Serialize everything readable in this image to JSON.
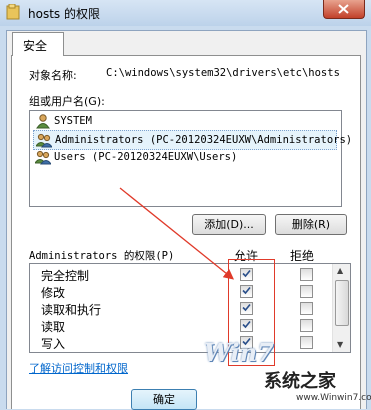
{
  "window": {
    "title": "hosts 的权限",
    "accent": "#c9dbee",
    "icons": {
      "folder": "folder-icon",
      "close": "close-icon"
    }
  },
  "tab": {
    "label": "安全"
  },
  "object": {
    "label": "对象名称:",
    "value": "C:\\windows\\system32\\drivers\\etc\\hosts"
  },
  "group": {
    "label": "组或用户名(G):",
    "items": [
      {
        "label": "SYSTEM",
        "icon": "user-icon"
      },
      {
        "label": "Administrators (PC-20120324EUXW\\Administrators)",
        "icon": "users-icon"
      },
      {
        "label": "Users (PC-20120324EUXW\\Users)",
        "icon": "users-icon"
      }
    ],
    "selected_index": 1
  },
  "buttons": {
    "add": "添加(D)...",
    "remove": "删除(R)",
    "ok": "确定"
  },
  "permissions": {
    "header": "Administrators 的权限(P)",
    "allow": "允许",
    "deny": "拒绝",
    "rows": [
      {
        "name": "完全控制",
        "allow": true,
        "deny": false
      },
      {
        "name": "修改",
        "allow": true,
        "deny": false
      },
      {
        "name": "读取和执行",
        "allow": true,
        "deny": false
      },
      {
        "name": "读取",
        "allow": true,
        "deny": false
      },
      {
        "name": "写入",
        "allow": true,
        "deny": false
      }
    ]
  },
  "link": "了解访问控制和权限",
  "watermark": {
    "logo": "Win7",
    "site": "系统之家",
    "url": "www.Winwin7.com"
  },
  "annotation_color": "#e03a2a"
}
